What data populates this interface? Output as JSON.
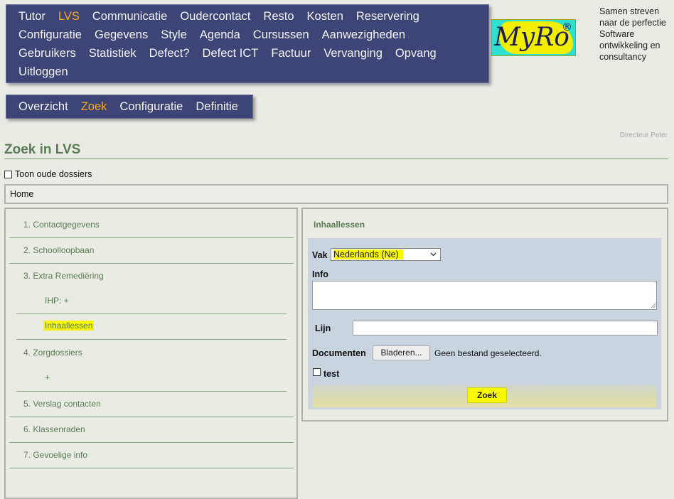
{
  "main_nav": {
    "rows": [
      [
        "Tutor",
        "LVS",
        "Communicatie",
        "Oudercontact",
        "Resto",
        "Kosten",
        "Reservering"
      ],
      [
        "Configuratie",
        "Gegevens",
        "Style",
        "Agenda",
        "Cursussen",
        "Aanwezigheden"
      ],
      [
        "Gebruikers",
        "Statistiek",
        "Defect?",
        "Defect ICT",
        "Factuur",
        "Vervanging",
        "Opvang"
      ],
      [
        "Uitloggen"
      ]
    ],
    "active": "LVS"
  },
  "sub_nav": {
    "items": [
      "Overzicht",
      "Zoek",
      "Configuratie",
      "Definitie"
    ],
    "active": "Zoek"
  },
  "logo": {
    "text": "MyRo",
    "mark": "®"
  },
  "tagline": "Samen streven naar de perfectie Software ontwikkeling en consultancy",
  "user": "Directeur Peter",
  "page_title": "Zoek in LVS",
  "old_dossiers_label": "Toon oude dossiers",
  "breadcrumb": "Home",
  "toc": {
    "items": [
      "1. Contactgegevens",
      "2. Schoolloopbaan",
      "3. Extra Remediëring",
      "IHP: +",
      "Inhaallessen",
      "4. Zorgdossiers",
      "+",
      "5. Verslag contacten",
      "6. Klassenraden",
      "7. Gevoelige info"
    ]
  },
  "form": {
    "heading": "Inhaallessen",
    "vak_label": "Vak",
    "vak_value": "Nederlands (Ne)",
    "info_label": "Info",
    "info_value": "",
    "lijn_label": "Lijn",
    "lijn_value": "",
    "documenten_label": "Documenten",
    "browse_label": "Bladeren...",
    "no_file_text": "Geen bestand geselecteerd.",
    "test_label": "test",
    "zoek_label": "Zoek"
  },
  "colors": {
    "nav_bg": "#3f4476",
    "nav_active": "#f6a81c",
    "title_green": "#5b7b55",
    "highlight": "#f7f700",
    "form_bg": "#c9d4de"
  }
}
